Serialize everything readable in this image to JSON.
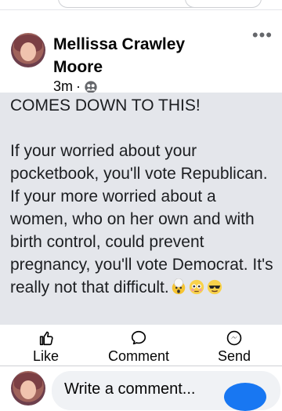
{
  "post": {
    "author": "Mellissa Crawley Moore",
    "time": "3m",
    "separator": "·",
    "privacy_icon": "friends-icon",
    "more_icon": "more-icon",
    "body_text": "COMES DOWN TO THIS!\n\nIf your worried about your pocketbook, you'll vote Republican. If your more worried about a women, who on her own and with birth control, could prevent pregnancy, you'll vote Democrat. It's really not that difficult."
  },
  "actions": {
    "like_label": "Like",
    "comment_label": "Comment",
    "send_label": "Send"
  },
  "composer": {
    "placeholder": "Write a comment..."
  }
}
